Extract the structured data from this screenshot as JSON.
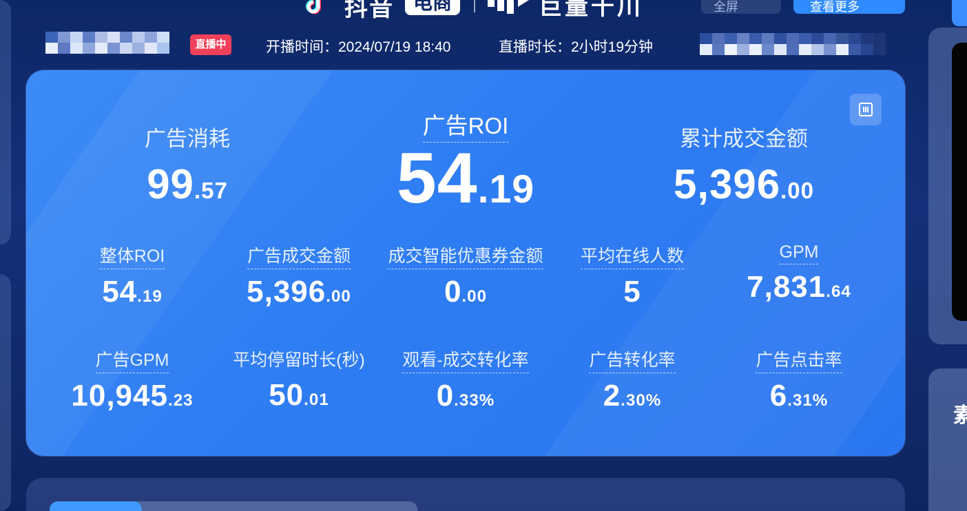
{
  "header": {
    "douyin_text": "抖音",
    "douyin_badge": "电商",
    "ocean_text": "巨量千川",
    "fullscreen_label": "全屏",
    "more_label": "查看更多"
  },
  "live_info": {
    "live_badge": "直播中",
    "start_time": "开播时间：2024/07/19 18:40",
    "duration": "直播时长：2小时19分钟"
  },
  "colors": {
    "accent": "#2f8bff",
    "live_red": "#f0405a",
    "card_blue": "#3d8bf6"
  },
  "metrics_top": [
    {
      "label": "广告消耗",
      "int": "99",
      "dec": ".57"
    },
    {
      "label": "广告ROI",
      "int": "54",
      "dec": ".19"
    },
    {
      "label": "累计成交金额",
      "int": "5,396",
      "dec": ".00"
    }
  ],
  "metrics_row2": [
    {
      "label": "整体ROI",
      "int": "54",
      "dec": ".19"
    },
    {
      "label": "广告成交金额",
      "int": "5,396",
      "dec": ".00"
    },
    {
      "label": "成交智能优惠券金额",
      "int": "0",
      "dec": ".00"
    },
    {
      "label": "平均在线人数",
      "int": "5",
      "dec": ""
    },
    {
      "label": "GPM",
      "int": "7,831",
      "dec": ".64"
    }
  ],
  "metrics_row3": [
    {
      "label": "广告GPM",
      "int": "10,945",
      "dec": ".23"
    },
    {
      "label": "平均停留时长(秒)",
      "int": "50",
      "dec": ".01"
    },
    {
      "label": "观看-成交转化率",
      "int": "0",
      "dec": ".33%"
    },
    {
      "label": "广告转化率",
      "int": "2",
      "dec": ".30%"
    },
    {
      "label": "广告点击率",
      "int": "6",
      "dec": ".31%"
    }
  ],
  "right_panel": {
    "partial_char": "素"
  }
}
